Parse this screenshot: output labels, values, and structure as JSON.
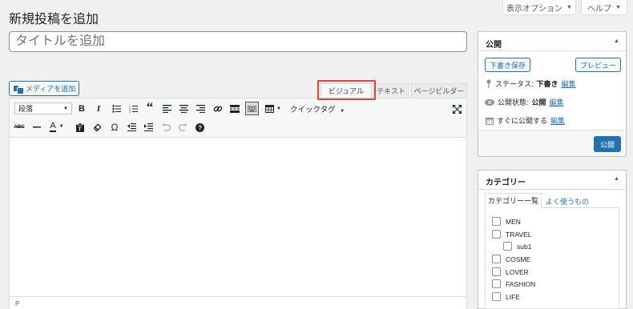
{
  "screen_meta": {
    "display_options": "表示オプション",
    "help": "ヘルプ"
  },
  "page_title": "新規投稿を追加",
  "title_field": {
    "placeholder": "タイトルを追加",
    "value": ""
  },
  "media_button": "メディアを追加",
  "editor_tabs": [
    "ビジュアル",
    "テキスト",
    "ページビルダー"
  ],
  "toolbar": {
    "format_select": "段落",
    "quick_tag": "クイックタグ",
    "row1_icons": [
      "bold-icon",
      "italic-icon",
      "bullet-list-icon",
      "numbered-list-icon",
      "blockquote-icon",
      "align-left-icon",
      "align-center-icon",
      "align-right-icon",
      "link-icon",
      "read-more-icon",
      "toolbar-toggle-icon",
      "table-icon"
    ],
    "row2_icons": [
      "strikethrough-icon",
      "horizontal-line-icon",
      "text-color-icon",
      "paste-text-icon",
      "clear-formatting-icon",
      "special-character-icon",
      "outdent-icon",
      "indent-icon",
      "undo-icon",
      "redo-icon",
      "help-icon"
    ]
  },
  "status_path": "P",
  "publish_box": {
    "title": "公開",
    "save_draft": "下書き保存",
    "preview": "プレビュー",
    "status_label": "ステータス:",
    "status_value": "下書き",
    "visibility_label": "公開状態:",
    "visibility_value": "公開",
    "schedule_label": "すぐに公開する",
    "edit_link": "編集",
    "publish_button": "公開"
  },
  "category_box": {
    "title": "カテゴリー",
    "tab_all": "カテゴリー一覧",
    "tab_popular": "よく使うもの",
    "items": [
      "MEN",
      "TRAVEL",
      "sub1",
      "COSME",
      "LOVER",
      "FASHION",
      "LIFE"
    ]
  },
  "colors": {
    "accent": "#2271b1",
    "highlight": "#e0443a"
  }
}
